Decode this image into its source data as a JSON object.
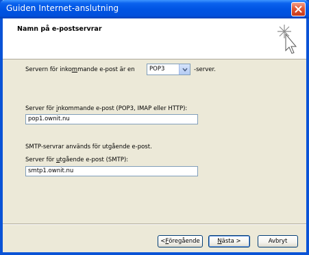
{
  "window": {
    "title": "Guiden Internet-anslutning"
  },
  "header": {
    "title": "Namn på e-postservrar",
    "icon": "wizard-sparkle-cursor-icon"
  },
  "incoming_type": {
    "label_before_prefix": "Servern för inko",
    "label_before_underlined": "m",
    "label_before_suffix": "mande e-post är en",
    "selected": "POP3",
    "label_after": "-server."
  },
  "incoming_server": {
    "label_prefix": "Server för ",
    "label_underlined": "i",
    "label_suffix": "nkommande e-post (POP3, IMAP eller HTTP):",
    "value": "pop1.ownit.nu"
  },
  "smtp_note": "SMTP-servrar används för utgående e-post.",
  "outgoing_server": {
    "label_prefix": "Server för ",
    "label_underlined": "u",
    "label_suffix": "tgående e-post (SMTP):",
    "value": "smtp1.ownit.nu"
  },
  "buttons": {
    "back_prefix": "< ",
    "back_underlined": "F",
    "back_suffix": "öregående",
    "next_underlined": "N",
    "next_suffix": "ästa >",
    "cancel": "Avbryt"
  },
  "colors": {
    "title_bar": "#0054e3",
    "dialog_bg": "#ece9d8",
    "close_button": "#e15734",
    "input_border": "#7f9db9"
  }
}
